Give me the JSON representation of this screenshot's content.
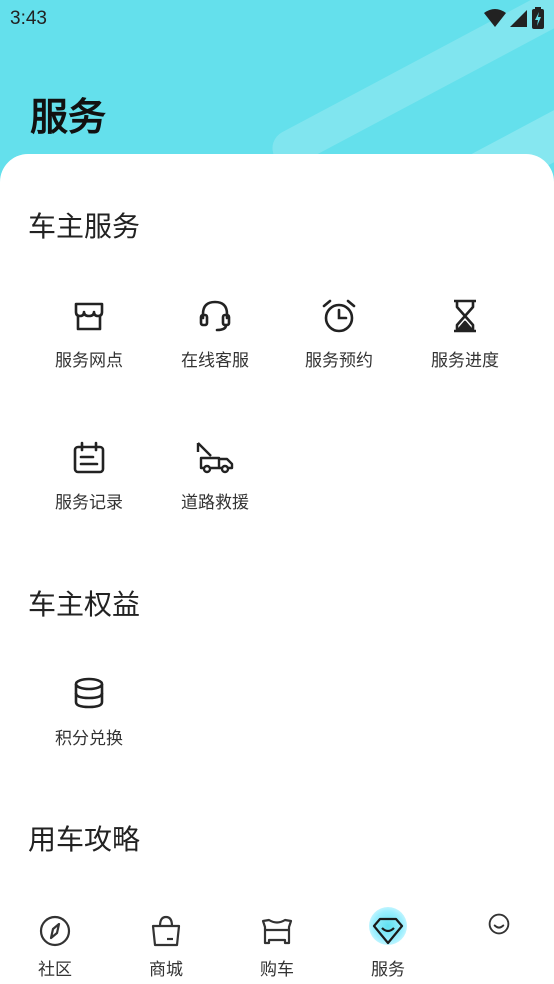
{
  "status": {
    "time": "3:43"
  },
  "header": {
    "title": "服务"
  },
  "sections": {
    "owner_services": {
      "title": "车主服务",
      "items": [
        {
          "label": "服务网点",
          "icon": "store-icon"
        },
        {
          "label": "在线客服",
          "icon": "headset-icon"
        },
        {
          "label": "服务预约",
          "icon": "alarm-clock-icon"
        },
        {
          "label": "服务进度",
          "icon": "hourglass-icon"
        },
        {
          "label": "服务记录",
          "icon": "calendar-record-icon"
        },
        {
          "label": "道路救援",
          "icon": "tow-truck-icon"
        }
      ]
    },
    "owner_benefits": {
      "title": "车主权益",
      "items": [
        {
          "label": "积分兑换",
          "icon": "coins-stack-icon"
        }
      ]
    },
    "car_guide": {
      "title": "用车攻略"
    }
  },
  "tabbar": {
    "items": [
      {
        "label": "社区",
        "icon": "compass-icon"
      },
      {
        "label": "商城",
        "icon": "shopping-bag-icon"
      },
      {
        "label": "购车",
        "icon": "car-front-icon"
      },
      {
        "label": "服务",
        "icon": "service-diamond-icon"
      },
      {
        "label": "",
        "icon": "smiley-icon"
      }
    ],
    "active_index": 3
  },
  "colors": {
    "header_bg": "#64e0ec",
    "accent": "#5fe0f0",
    "text": "#222222"
  }
}
